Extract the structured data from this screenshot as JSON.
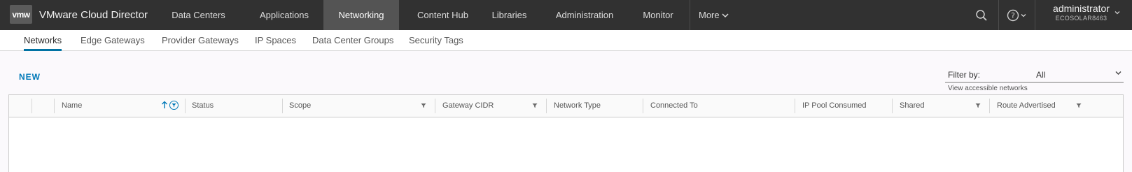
{
  "header": {
    "logo": "vmw",
    "title": "VMware Cloud Director",
    "nav": [
      "Data Centers",
      "Applications",
      "Networking",
      "Content Hub",
      "Libraries",
      "Administration",
      "Monitor"
    ],
    "more_label": "More",
    "search_icon": "search-icon",
    "help_icon": "help-icon",
    "user": {
      "name": "administrator",
      "org": "ECOSOLAR8463"
    }
  },
  "subtabs": [
    "Networks",
    "Edge Gateways",
    "Provider Gateways",
    "IP Spaces",
    "Data Center Groups",
    "Security Tags"
  ],
  "toolbar": {
    "new_label": "NEW",
    "filter_label": "Filter by:",
    "filter_value": "All",
    "filter_hint": "View accessible networks"
  },
  "grid": {
    "columns": [
      "Name",
      "Status",
      "Scope",
      "Gateway CIDR",
      "Network Type",
      "Connected To",
      "IP Pool Consumed",
      "Shared",
      "Route Advertised"
    ]
  },
  "colors": {
    "accent": "#0079b8",
    "header_bg": "#313131",
    "active_nav_bg": "#545454"
  }
}
